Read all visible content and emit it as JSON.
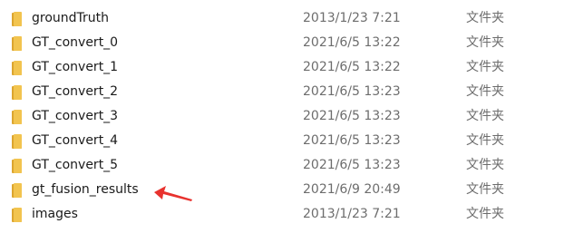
{
  "files": [
    {
      "name": "groundTruth",
      "modified": "2013/1/23 7:21",
      "type": "文件夹",
      "icon": "folder-icon"
    },
    {
      "name": "GT_convert_0",
      "modified": "2021/6/5 13:22",
      "type": "文件夹",
      "icon": "folder-icon"
    },
    {
      "name": "GT_convert_1",
      "modified": "2021/6/5 13:22",
      "type": "文件夹",
      "icon": "folder-icon"
    },
    {
      "name": "GT_convert_2",
      "modified": "2021/6/5 13:23",
      "type": "文件夹",
      "icon": "folder-icon"
    },
    {
      "name": "GT_convert_3",
      "modified": "2021/6/5 13:23",
      "type": "文件夹",
      "icon": "folder-icon"
    },
    {
      "name": "GT_convert_4",
      "modified": "2021/6/5 13:23",
      "type": "文件夹",
      "icon": "folder-icon"
    },
    {
      "name": "GT_convert_5",
      "modified": "2021/6/5 13:23",
      "type": "文件夹",
      "icon": "folder-icon"
    },
    {
      "name": "gt_fusion_results",
      "modified": "2021/6/9 20:49",
      "type": "文件夹",
      "icon": "folder-icon"
    },
    {
      "name": "images",
      "modified": "2013/1/23 7:21",
      "type": "文件夹",
      "icon": "folder-icon"
    }
  ],
  "annotation": {
    "icon": "red-arrow-icon",
    "color": "#e8322e"
  },
  "colors": {
    "folder": "#f2c44f",
    "folder_dark": "#dca52f",
    "secondary_text": "#6d6d6d"
  }
}
